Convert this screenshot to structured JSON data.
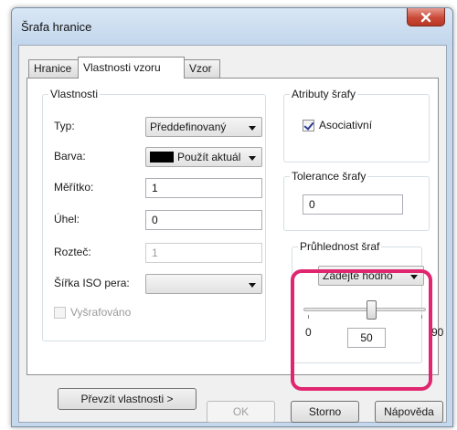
{
  "window": {
    "title": "Šrafa hranice"
  },
  "tabs": [
    "Hranice",
    "Vlastnosti vzoru",
    "Vzor"
  ],
  "properties": {
    "group_label": "Vlastnosti",
    "type": {
      "label": "Typ:",
      "value": "Předdefinovaný"
    },
    "color": {
      "label": "Barva:",
      "value": "Použít aktuál",
      "swatch": "#000000"
    },
    "scale": {
      "label": "Měřítko:",
      "value": "1"
    },
    "angle": {
      "label": "Úhel:",
      "value": "0"
    },
    "spacing": {
      "label": "Rozteč:",
      "value": "1"
    },
    "iso_pen_width": {
      "label": "Šířka ISO pera:",
      "value": ""
    },
    "double_hatch": {
      "label": "Vyšrafováno",
      "checked": false,
      "enabled": false
    }
  },
  "inherit_button": "Převzít vlastnosti >",
  "hatch_attributes": {
    "group_label": "Atributy šrafy",
    "associative": {
      "label": "Asociativní",
      "checked": true
    }
  },
  "gap_tolerance": {
    "group_label": "Tolerance šrafy",
    "value": "0"
  },
  "transparency": {
    "group_label": "Průhlednost šraf",
    "mode": "Zadejte hodno",
    "min": "0",
    "max": "90",
    "value": "50",
    "fraction": 0.556
  },
  "footer": {
    "ok": "OK",
    "cancel": "Storno",
    "help": "Nápověda"
  },
  "colors": {
    "highlight": "#e0266f",
    "close_button": "#c94a39",
    "checkmark": "#2a3a8e"
  }
}
